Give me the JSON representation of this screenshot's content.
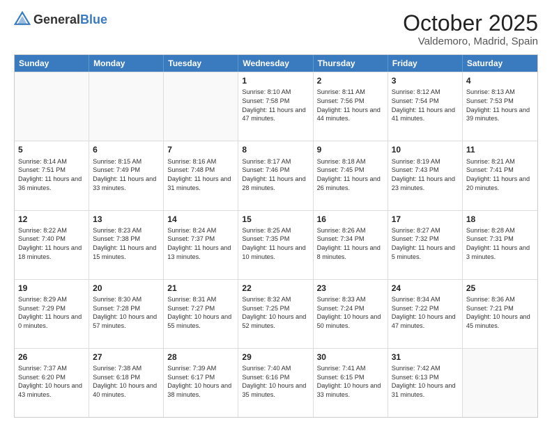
{
  "header": {
    "logo_general": "General",
    "logo_blue": "Blue",
    "month": "October 2025",
    "location": "Valdemoro, Madrid, Spain"
  },
  "days_of_week": [
    "Sunday",
    "Monday",
    "Tuesday",
    "Wednesday",
    "Thursday",
    "Friday",
    "Saturday"
  ],
  "weeks": [
    [
      {
        "day": "",
        "info": ""
      },
      {
        "day": "",
        "info": ""
      },
      {
        "day": "",
        "info": ""
      },
      {
        "day": "1",
        "info": "Sunrise: 8:10 AM\nSunset: 7:58 PM\nDaylight: 11 hours and 47 minutes."
      },
      {
        "day": "2",
        "info": "Sunrise: 8:11 AM\nSunset: 7:56 PM\nDaylight: 11 hours and 44 minutes."
      },
      {
        "day": "3",
        "info": "Sunrise: 8:12 AM\nSunset: 7:54 PM\nDaylight: 11 hours and 41 minutes."
      },
      {
        "day": "4",
        "info": "Sunrise: 8:13 AM\nSunset: 7:53 PM\nDaylight: 11 hours and 39 minutes."
      }
    ],
    [
      {
        "day": "5",
        "info": "Sunrise: 8:14 AM\nSunset: 7:51 PM\nDaylight: 11 hours and 36 minutes."
      },
      {
        "day": "6",
        "info": "Sunrise: 8:15 AM\nSunset: 7:49 PM\nDaylight: 11 hours and 33 minutes."
      },
      {
        "day": "7",
        "info": "Sunrise: 8:16 AM\nSunset: 7:48 PM\nDaylight: 11 hours and 31 minutes."
      },
      {
        "day": "8",
        "info": "Sunrise: 8:17 AM\nSunset: 7:46 PM\nDaylight: 11 hours and 28 minutes."
      },
      {
        "day": "9",
        "info": "Sunrise: 8:18 AM\nSunset: 7:45 PM\nDaylight: 11 hours and 26 minutes."
      },
      {
        "day": "10",
        "info": "Sunrise: 8:19 AM\nSunset: 7:43 PM\nDaylight: 11 hours and 23 minutes."
      },
      {
        "day": "11",
        "info": "Sunrise: 8:21 AM\nSunset: 7:41 PM\nDaylight: 11 hours and 20 minutes."
      }
    ],
    [
      {
        "day": "12",
        "info": "Sunrise: 8:22 AM\nSunset: 7:40 PM\nDaylight: 11 hours and 18 minutes."
      },
      {
        "day": "13",
        "info": "Sunrise: 8:23 AM\nSunset: 7:38 PM\nDaylight: 11 hours and 15 minutes."
      },
      {
        "day": "14",
        "info": "Sunrise: 8:24 AM\nSunset: 7:37 PM\nDaylight: 11 hours and 13 minutes."
      },
      {
        "day": "15",
        "info": "Sunrise: 8:25 AM\nSunset: 7:35 PM\nDaylight: 11 hours and 10 minutes."
      },
      {
        "day": "16",
        "info": "Sunrise: 8:26 AM\nSunset: 7:34 PM\nDaylight: 11 hours and 8 minutes."
      },
      {
        "day": "17",
        "info": "Sunrise: 8:27 AM\nSunset: 7:32 PM\nDaylight: 11 hours and 5 minutes."
      },
      {
        "day": "18",
        "info": "Sunrise: 8:28 AM\nSunset: 7:31 PM\nDaylight: 11 hours and 3 minutes."
      }
    ],
    [
      {
        "day": "19",
        "info": "Sunrise: 8:29 AM\nSunset: 7:29 PM\nDaylight: 11 hours and 0 minutes."
      },
      {
        "day": "20",
        "info": "Sunrise: 8:30 AM\nSunset: 7:28 PM\nDaylight: 10 hours and 57 minutes."
      },
      {
        "day": "21",
        "info": "Sunrise: 8:31 AM\nSunset: 7:27 PM\nDaylight: 10 hours and 55 minutes."
      },
      {
        "day": "22",
        "info": "Sunrise: 8:32 AM\nSunset: 7:25 PM\nDaylight: 10 hours and 52 minutes."
      },
      {
        "day": "23",
        "info": "Sunrise: 8:33 AM\nSunset: 7:24 PM\nDaylight: 10 hours and 50 minutes."
      },
      {
        "day": "24",
        "info": "Sunrise: 8:34 AM\nSunset: 7:22 PM\nDaylight: 10 hours and 47 minutes."
      },
      {
        "day": "25",
        "info": "Sunrise: 8:36 AM\nSunset: 7:21 PM\nDaylight: 10 hours and 45 minutes."
      }
    ],
    [
      {
        "day": "26",
        "info": "Sunrise: 7:37 AM\nSunset: 6:20 PM\nDaylight: 10 hours and 43 minutes."
      },
      {
        "day": "27",
        "info": "Sunrise: 7:38 AM\nSunset: 6:18 PM\nDaylight: 10 hours and 40 minutes."
      },
      {
        "day": "28",
        "info": "Sunrise: 7:39 AM\nSunset: 6:17 PM\nDaylight: 10 hours and 38 minutes."
      },
      {
        "day": "29",
        "info": "Sunrise: 7:40 AM\nSunset: 6:16 PM\nDaylight: 10 hours and 35 minutes."
      },
      {
        "day": "30",
        "info": "Sunrise: 7:41 AM\nSunset: 6:15 PM\nDaylight: 10 hours and 33 minutes."
      },
      {
        "day": "31",
        "info": "Sunrise: 7:42 AM\nSunset: 6:13 PM\nDaylight: 10 hours and 31 minutes."
      },
      {
        "day": "",
        "info": ""
      }
    ]
  ]
}
